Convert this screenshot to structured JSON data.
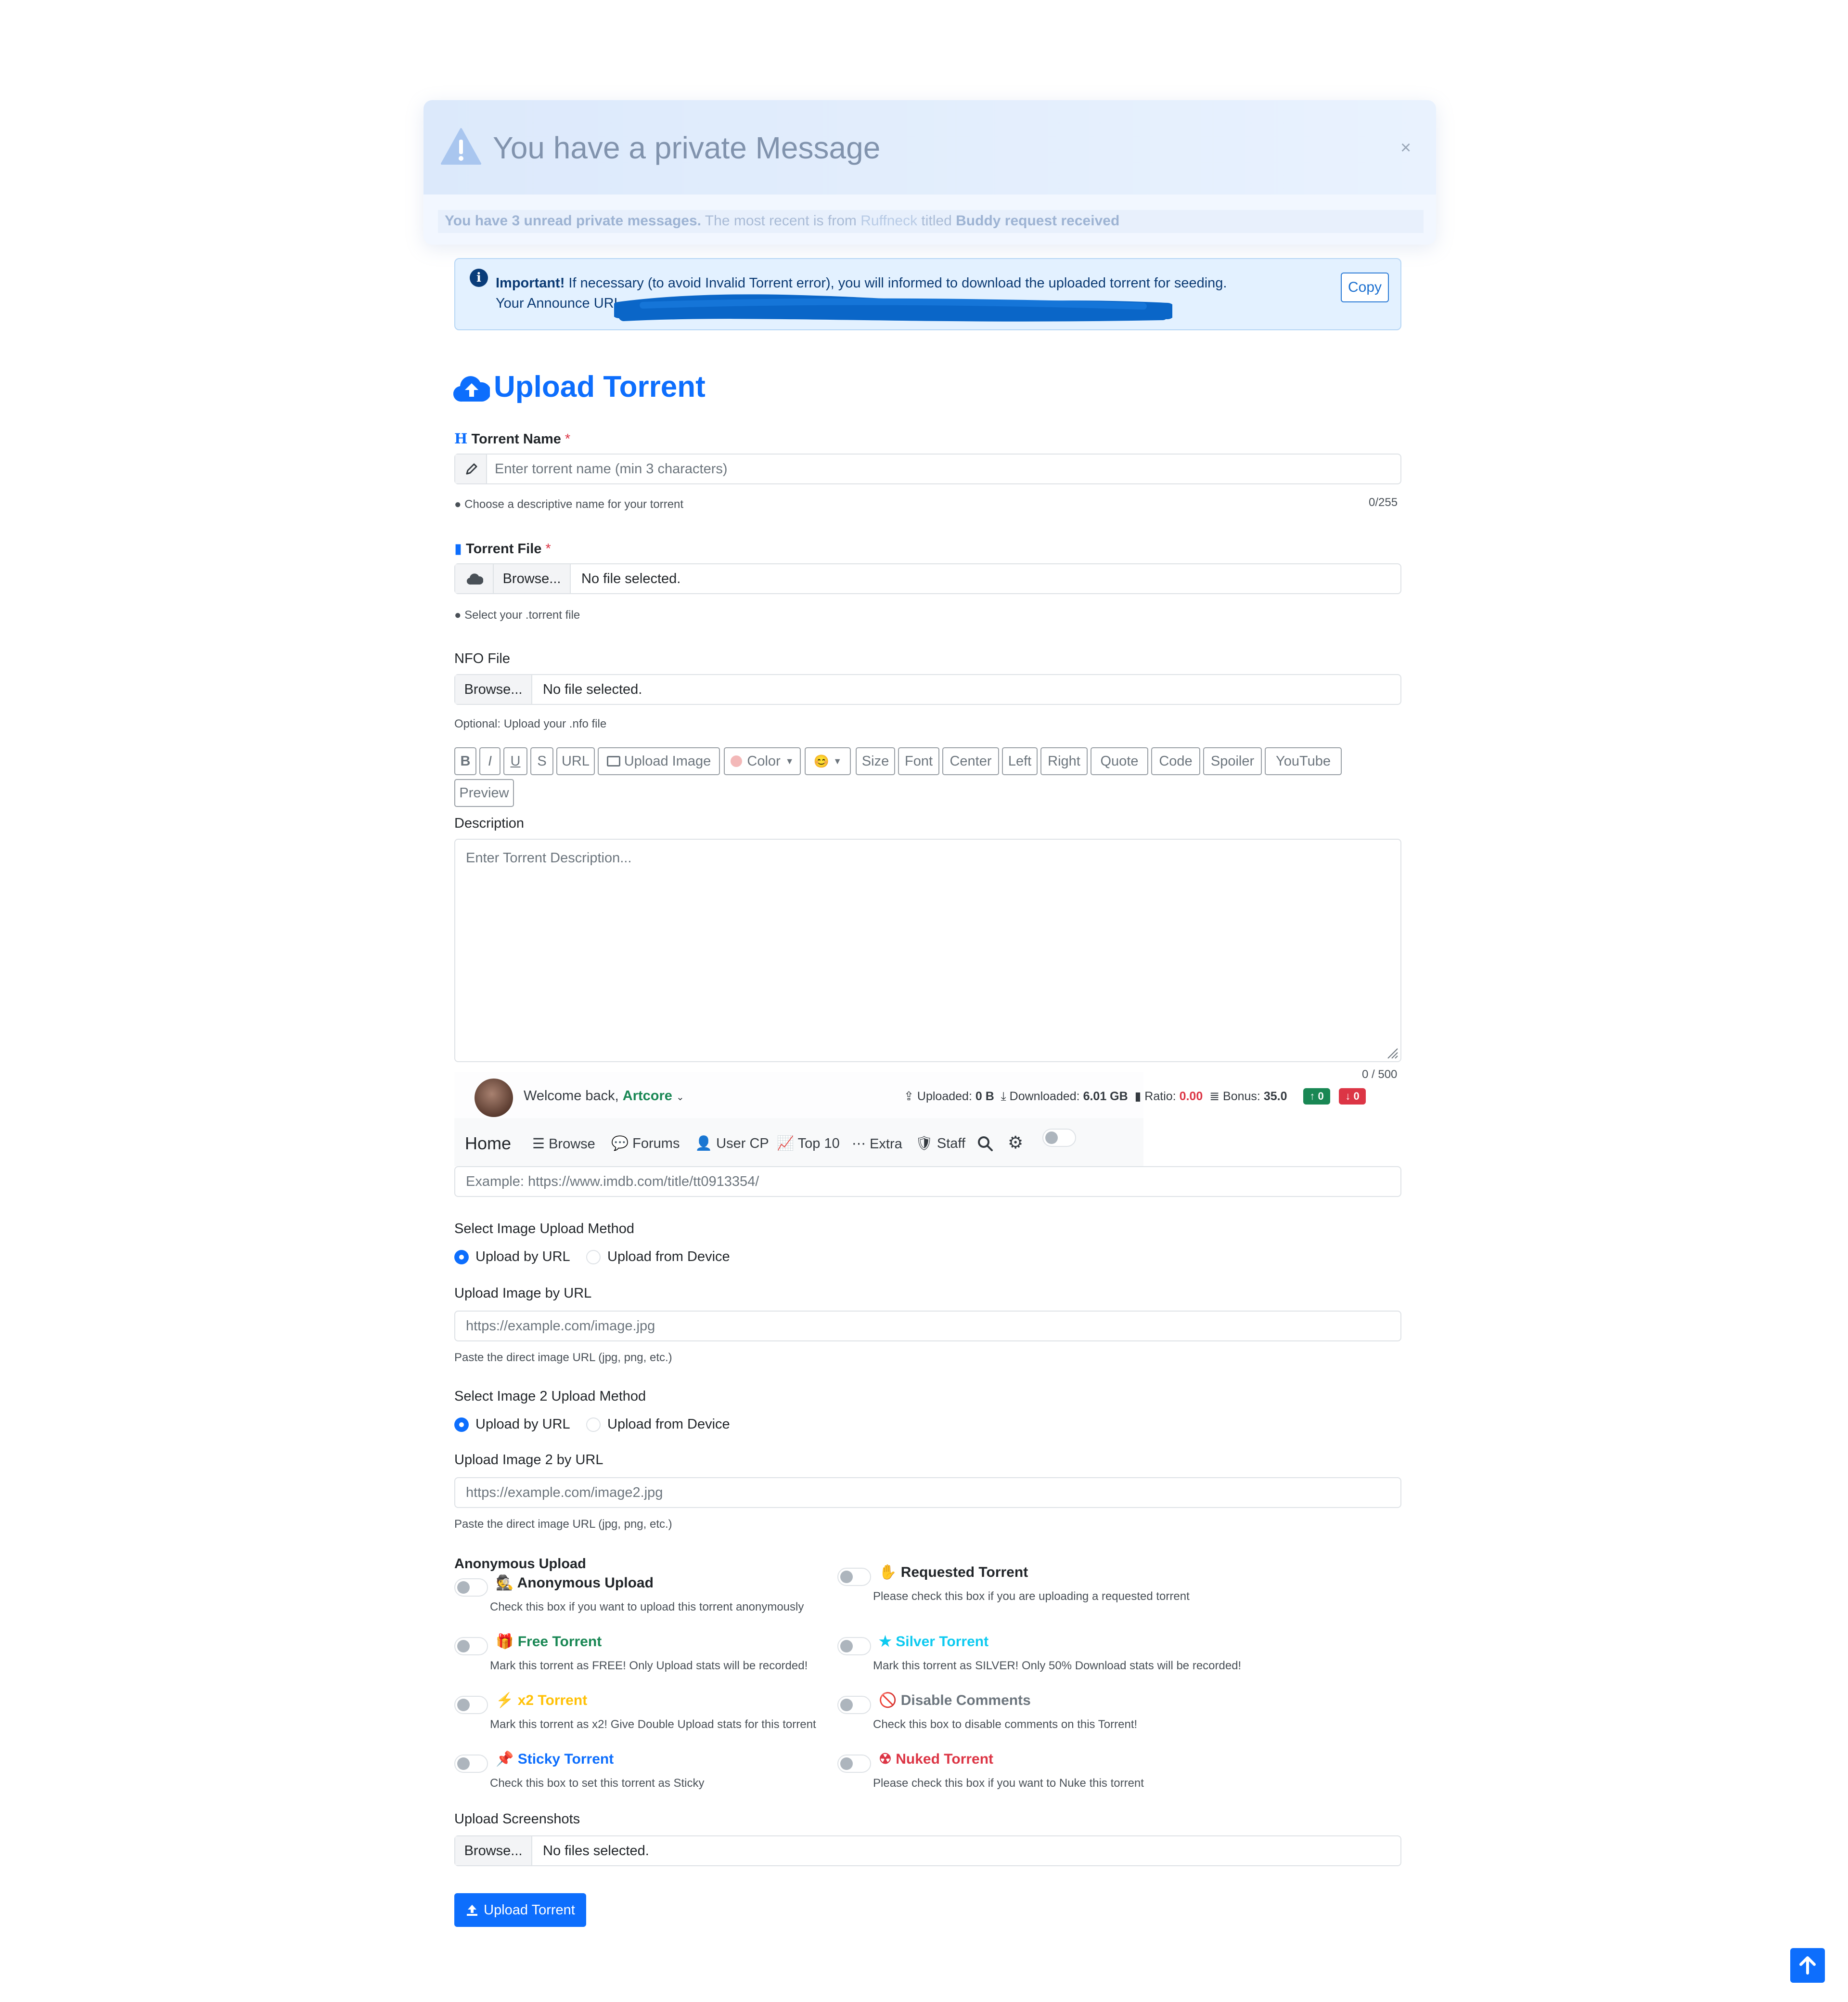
{
  "pm_alert": {
    "title": "You have a private Message",
    "close": "×",
    "unread": "You have 3 unread private messages.",
    "mid": " The most recent is from ",
    "sender": "Ruffneck",
    "titled": " titled ",
    "subject": "Buddy request received"
  },
  "info": {
    "important": "Important!",
    "line1_rest": " If necessary (to avoid Invalid Torrent error), you will informed to download the uploaded torrent for seeding.",
    "line2": "Your Announce URL",
    "copy": "Copy"
  },
  "page_title": "Upload Torrent",
  "torrent_name": {
    "label": "Torrent Name",
    "required": "*",
    "placeholder": "Enter torrent name (min 3 characters)",
    "hint": "Choose a descriptive name for your torrent",
    "counter": "0/255"
  },
  "torrent_file": {
    "label": "Torrent File",
    "required": "*",
    "browse": "Browse...",
    "status": "No file selected.",
    "hint": "Select your .torrent file"
  },
  "nfo_file": {
    "label": "NFO File",
    "browse": "Browse...",
    "status": "No file selected.",
    "hint": "Optional: Upload your .nfo file"
  },
  "toolbar": [
    "B",
    "I",
    "U",
    "S",
    "URL",
    "Upload Image",
    "Color",
    "😊",
    "Size",
    "Font",
    "Center",
    "Left",
    "Right",
    "Quote",
    "Code",
    "Spoiler",
    "YouTube",
    "Preview"
  ],
  "description": {
    "label": "Description",
    "placeholder": "Enter Torrent Description...",
    "counter": "0 / 500"
  },
  "user_bar": {
    "welcome": "Welcome back, ",
    "username": "Artcore",
    "uploaded_label": "Uploaded:",
    "uploaded": "0 B",
    "downloaded_label": "Downloaded:",
    "downloaded": "6.01 GB",
    "ratio_label": "Ratio:",
    "ratio": "0.00",
    "bonus_label": "Bonus:",
    "bonus": "35.0",
    "seeding": "0",
    "leeching": "0"
  },
  "nav": {
    "home": "Home",
    "browse": "Browse",
    "forums": "Forums",
    "usercp": "User CP",
    "top10": "Top 10",
    "extra": "Extra",
    "staff": "Staff"
  },
  "imdb": {
    "placeholder": "Example: https://www.imdb.com/title/tt0913354/"
  },
  "image1": {
    "method_label": "Select Image Upload Method",
    "opt_url": "Upload by URL",
    "opt_device": "Upload from Device",
    "url_label": "Upload Image by URL",
    "placeholder": "https://example.com/image.jpg",
    "hint": "Paste the direct image URL (jpg, png, etc.)"
  },
  "image2": {
    "method_label": "Select Image 2 Upload Method",
    "opt_url": "Upload by URL",
    "opt_device": "Upload from Device",
    "url_label": "Upload Image 2 by URL",
    "placeholder": "https://example.com/image2.jpg",
    "hint": "Paste the direct image URL (jpg, png, etc.)"
  },
  "anon_header": "Anonymous Upload",
  "options": {
    "anonymous": {
      "title": "Anonymous Upload",
      "desc": "Check this box if you want to upload this torrent anonymously",
      "color": "#212529"
    },
    "requested": {
      "title": "Requested Torrent",
      "desc": "Please check this box if you are uploading a requested torrent",
      "color": "#212529"
    },
    "free": {
      "title": "Free Torrent",
      "desc": "Mark this torrent as FREE! Only Upload stats will be recorded!",
      "color": "#198754"
    },
    "silver": {
      "title": "Silver Torrent",
      "desc": "Mark this torrent as SILVER! Only 50% Download stats will be recorded!",
      "color": "#0dcaf0"
    },
    "x2": {
      "title": "x2 Torrent",
      "desc": "Mark this torrent as x2! Give Double Upload stats for this torrent",
      "color": "#ffc107"
    },
    "disable_comments": {
      "title": "Disable Comments",
      "desc": "Check this box to disable comments on this Torrent!",
      "color": "#6c757d"
    },
    "sticky": {
      "title": "Sticky Torrent",
      "desc": "Check this box to set this torrent as Sticky",
      "color": "#0d6efd"
    },
    "nuked": {
      "title": "Nuked Torrent",
      "desc": "Please check this box if you want to Nuke this torrent",
      "color": "#dc3545"
    }
  },
  "screenshots": {
    "label": "Upload Screenshots",
    "browse": "Browse...",
    "status": "No files selected."
  },
  "submit": "Upload Torrent"
}
